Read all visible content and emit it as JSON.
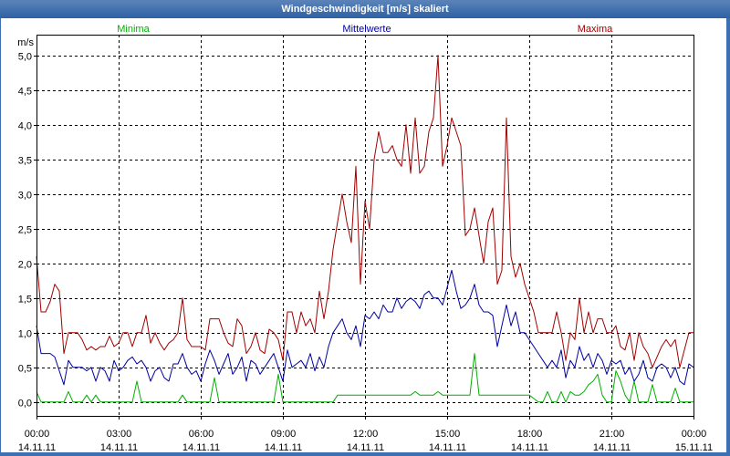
{
  "window": {
    "frame_color": "#3d6fb3",
    "title_bar_color": "#2e61a5",
    "title_text_color": "#ffffff"
  },
  "chart_data": {
    "type": "line",
    "title": "Windgeschwindigkeit [m/s] skaliert",
    "ylabel": "m/s",
    "ylim": [
      -0.2,
      5.3
    ],
    "yticks": [
      0,
      0.5,
      1,
      1.5,
      2,
      2.5,
      3,
      3.5,
      4,
      4.5,
      5
    ],
    "ytick_labels": [
      "0,0",
      "0,5",
      "1,0",
      "1,5",
      "2,0",
      "2,5",
      "3,0",
      "3,5",
      "4,0",
      "4,5",
      "5,0"
    ],
    "xlim": [
      "14.11.11 00:00",
      "15.11.11 00:00"
    ],
    "xticks": [
      {
        "time": "00:00",
        "date": "14.11.11"
      },
      {
        "time": "03:00",
        "date": "14.11.11"
      },
      {
        "time": "06:00",
        "date": "14.11.11"
      },
      {
        "time": "09:00",
        "date": "14.11.11"
      },
      {
        "time": "12:00",
        "date": "14.11.11"
      },
      {
        "time": "15:00",
        "date": "14.11.11"
      },
      {
        "time": "18:00",
        "date": "14.11.11"
      },
      {
        "time": "21:00",
        "date": "14.11.11"
      },
      {
        "time": "00:00",
        "date": "15.11.11"
      }
    ],
    "grid": true,
    "legend": "top",
    "x": [
      "14.11.11 00:00",
      "14.11.11 00:10",
      "14.11.11 00:20",
      "14.11.11 00:30",
      "14.11.11 00:40",
      "14.11.11 00:50",
      "14.11.11 01:00",
      "14.11.11 01:10",
      "14.11.11 01:20",
      "14.11.11 01:30",
      "14.11.11 01:40",
      "14.11.11 01:50",
      "14.11.11 02:00",
      "14.11.11 02:10",
      "14.11.11 02:20",
      "14.11.11 02:30",
      "14.11.11 02:40",
      "14.11.11 02:50",
      "14.11.11 03:00",
      "14.11.11 03:10",
      "14.11.11 03:20",
      "14.11.11 03:30",
      "14.11.11 03:40",
      "14.11.11 03:50",
      "14.11.11 04:00",
      "14.11.11 04:10",
      "14.11.11 04:20",
      "14.11.11 04:30",
      "14.11.11 04:40",
      "14.11.11 04:50",
      "14.11.11 05:00",
      "14.11.11 05:10",
      "14.11.11 05:20",
      "14.11.11 05:30",
      "14.11.11 05:40",
      "14.11.11 05:50",
      "14.11.11 06:00",
      "14.11.11 06:10",
      "14.11.11 06:20",
      "14.11.11 06:30",
      "14.11.11 06:40",
      "14.11.11 06:50",
      "14.11.11 07:00",
      "14.11.11 07:10",
      "14.11.11 07:20",
      "14.11.11 07:30",
      "14.11.11 07:40",
      "14.11.11 07:50",
      "14.11.11 08:00",
      "14.11.11 08:10",
      "14.11.11 08:20",
      "14.11.11 08:30",
      "14.11.11 08:40",
      "14.11.11 08:50",
      "14.11.11 09:00",
      "14.11.11 09:10",
      "14.11.11 09:20",
      "14.11.11 09:30",
      "14.11.11 09:40",
      "14.11.11 09:50",
      "14.11.11 10:00",
      "14.11.11 10:10",
      "14.11.11 10:20",
      "14.11.11 10:30",
      "14.11.11 10:40",
      "14.11.11 10:50",
      "14.11.11 11:00",
      "14.11.11 11:10",
      "14.11.11 11:20",
      "14.11.11 11:30",
      "14.11.11 11:40",
      "14.11.11 11:50",
      "14.11.11 12:00",
      "14.11.11 12:10",
      "14.11.11 12:20",
      "14.11.11 12:30",
      "14.11.11 12:40",
      "14.11.11 12:50",
      "14.11.11 13:00",
      "14.11.11 13:10",
      "14.11.11 13:20",
      "14.11.11 13:30",
      "14.11.11 13:40",
      "14.11.11 13:50",
      "14.11.11 14:00",
      "14.11.11 14:10",
      "14.11.11 14:20",
      "14.11.11 14:30",
      "14.11.11 14:40",
      "14.11.11 14:50",
      "14.11.11 15:00",
      "14.11.11 15:10",
      "14.11.11 15:20",
      "14.11.11 15:30",
      "14.11.11 15:40",
      "14.11.11 15:50",
      "14.11.11 16:00",
      "14.11.11 16:10",
      "14.11.11 16:20",
      "14.11.11 16:30",
      "14.11.11 16:40",
      "14.11.11 16:50",
      "14.11.11 17:00",
      "14.11.11 17:10",
      "14.11.11 17:20",
      "14.11.11 17:30",
      "14.11.11 17:40",
      "14.11.11 17:50",
      "14.11.11 18:00",
      "14.11.11 18:10",
      "14.11.11 18:20",
      "14.11.11 18:30",
      "14.11.11 18:40",
      "14.11.11 18:50",
      "14.11.11 19:00",
      "14.11.11 19:10",
      "14.11.11 19:20",
      "14.11.11 19:30",
      "14.11.11 19:40",
      "14.11.11 19:50",
      "14.11.11 20:00",
      "14.11.11 20:10",
      "14.11.11 20:20",
      "14.11.11 20:30",
      "14.11.11 20:40",
      "14.11.11 20:50",
      "14.11.11 21:00",
      "14.11.11 21:10",
      "14.11.11 21:20",
      "14.11.11 21:30",
      "14.11.11 21:40",
      "14.11.11 21:50",
      "14.11.11 22:00",
      "14.11.11 22:10",
      "14.11.11 22:20",
      "14.11.11 22:30",
      "14.11.11 22:40",
      "14.11.11 22:50",
      "14.11.11 23:00",
      "14.11.11 23:10",
      "14.11.11 23:20",
      "14.11.11 23:30",
      "14.11.11 23:40",
      "14.11.11 23:50",
      "15.11.11 00:00"
    ],
    "series": [
      {
        "name": "Minima",
        "color": "#00b000",
        "values": [
          0.15,
          0,
          0,
          0,
          0,
          0,
          0,
          0.15,
          0,
          0,
          0,
          0.1,
          0,
          0.1,
          0,
          0,
          0,
          0,
          0,
          0,
          0,
          0,
          0.3,
          0,
          0,
          0,
          0,
          0,
          0,
          0,
          0,
          0,
          0.1,
          0,
          0,
          0,
          0,
          0,
          0,
          0.35,
          0,
          0,
          0,
          0,
          0,
          0,
          0,
          0,
          0,
          0,
          0,
          0,
          0,
          0.4,
          0,
          0,
          0,
          0,
          0,
          0,
          0,
          0,
          0,
          0,
          0,
          0,
          0.1,
          0.1,
          0.1,
          0.1,
          0.1,
          0.1,
          0.1,
          0.1,
          0.1,
          0.1,
          0.1,
          0.1,
          0.1,
          0.1,
          0.1,
          0.1,
          0.1,
          0.15,
          0.1,
          0.1,
          0.1,
          0.1,
          0.15,
          0.1,
          0.1,
          0.1,
          0.1,
          0.1,
          0.1,
          0.1,
          0.7,
          0.1,
          0.1,
          0.1,
          0.1,
          0.1,
          0.1,
          0.1,
          0.1,
          0.1,
          0.1,
          0.1,
          0.1,
          0.05,
          0,
          0,
          0.15,
          0,
          0,
          0.15,
          0,
          0.15,
          0.1,
          0.1,
          0.15,
          0.25,
          0.3,
          0.4,
          0.1,
          0,
          0,
          0.45,
          0.3,
          0.1,
          0,
          0.3,
          0,
          0,
          0,
          0.25,
          0,
          0,
          0,
          0,
          0.2,
          0,
          0,
          0,
          0
        ]
      },
      {
        "name": "Mittelwerte",
        "color": "#0000a0",
        "values": [
          1.1,
          0.7,
          0.7,
          0.7,
          0.65,
          0.45,
          0.25,
          0.6,
          0.5,
          0.5,
          0.5,
          0.45,
          0.5,
          0.3,
          0.5,
          0.45,
          0.3,
          0.6,
          0.45,
          0.5,
          0.6,
          0.65,
          0.55,
          0.6,
          0.5,
          0.3,
          0.45,
          0.5,
          0.35,
          0.3,
          0.55,
          0.55,
          0.7,
          0.5,
          0.4,
          0.45,
          0.3,
          0.55,
          0.75,
          0.6,
          0.4,
          0.55,
          0.7,
          0.4,
          0.5,
          0.65,
          0.3,
          0.6,
          0.55,
          0.4,
          0.5,
          0.6,
          0.7,
          0.5,
          0.3,
          0.75,
          0.5,
          0.55,
          0.6,
          0.5,
          0.7,
          0.45,
          0.65,
          0.5,
          0.8,
          1.0,
          1.1,
          1.2,
          1.0,
          0.9,
          1.1,
          0.8,
          1.25,
          1.2,
          1.3,
          1.2,
          1.4,
          1.3,
          1.3,
          1.5,
          1.35,
          1.45,
          1.5,
          1.45,
          1.35,
          1.55,
          1.6,
          1.5,
          1.5,
          1.4,
          1.65,
          1.9,
          1.6,
          1.35,
          1.4,
          1.5,
          1.7,
          1.4,
          1.3,
          1.3,
          1.25,
          0.8,
          1.1,
          1.4,
          1.1,
          1.3,
          1.0,
          1.0,
          0.9,
          0.8,
          0.7,
          0.6,
          0.5,
          0.6,
          0.5,
          0.75,
          0.35,
          0.6,
          0.5,
          0.8,
          0.6,
          0.7,
          0.5,
          0.7,
          0.6,
          0.4,
          0.6,
          0.55,
          0.6,
          0.4,
          0.5,
          0.3,
          0.4,
          0.6,
          0.35,
          0.3,
          0.5,
          0.55,
          0.5,
          0.35,
          0.5,
          0.3,
          0.25,
          0.55,
          0.5
        ]
      },
      {
        "name": "Maxima",
        "color": "#a00000",
        "values": [
          2.1,
          1.3,
          1.3,
          1.45,
          1.7,
          1.6,
          0.7,
          1.0,
          1.0,
          1.0,
          0.9,
          0.75,
          0.8,
          0.75,
          0.8,
          0.8,
          0.95,
          0.8,
          0.85,
          1.0,
          1.0,
          0.8,
          1.0,
          1.0,
          1.25,
          0.85,
          1.0,
          0.85,
          0.75,
          0.85,
          0.9,
          1.0,
          1.5,
          0.9,
          0.8,
          0.8,
          0.8,
          0.75,
          1.2,
          1.2,
          1.2,
          1.0,
          0.85,
          0.8,
          1.2,
          1.1,
          0.7,
          0.8,
          1.0,
          0.75,
          0.7,
          1.05,
          1.0,
          0.9,
          0.6,
          1.3,
          1.3,
          1.0,
          1.3,
          1.1,
          1.2,
          1.0,
          1.6,
          1.2,
          1.6,
          2.2,
          2.6,
          3.0,
          2.6,
          2.3,
          3.4,
          1.7,
          2.9,
          2.5,
          3.5,
          3.9,
          3.6,
          3.6,
          3.7,
          3.5,
          3.4,
          4.0,
          3.3,
          4.1,
          3.3,
          3.4,
          3.9,
          4.1,
          5.0,
          3.4,
          3.7,
          4.1,
          3.9,
          3.7,
          2.4,
          2.5,
          2.8,
          2.4,
          2.0,
          2.6,
          2.8,
          1.7,
          1.9,
          4.1,
          2.1,
          1.8,
          2.0,
          1.7,
          1.5,
          1.3,
          1.0,
          1.0,
          1.0,
          1.0,
          1.3,
          1.0,
          0.6,
          1.0,
          0.9,
          1.5,
          1.0,
          1.3,
          1.0,
          1.2,
          1.2,
          1.0,
          1.0,
          1.1,
          0.8,
          0.75,
          1.0,
          0.6,
          1.0,
          0.8,
          0.7,
          0.5,
          0.65,
          0.8,
          0.9,
          0.8,
          0.9,
          0.5,
          0.75,
          1.0,
          1.0
        ]
      }
    ]
  }
}
